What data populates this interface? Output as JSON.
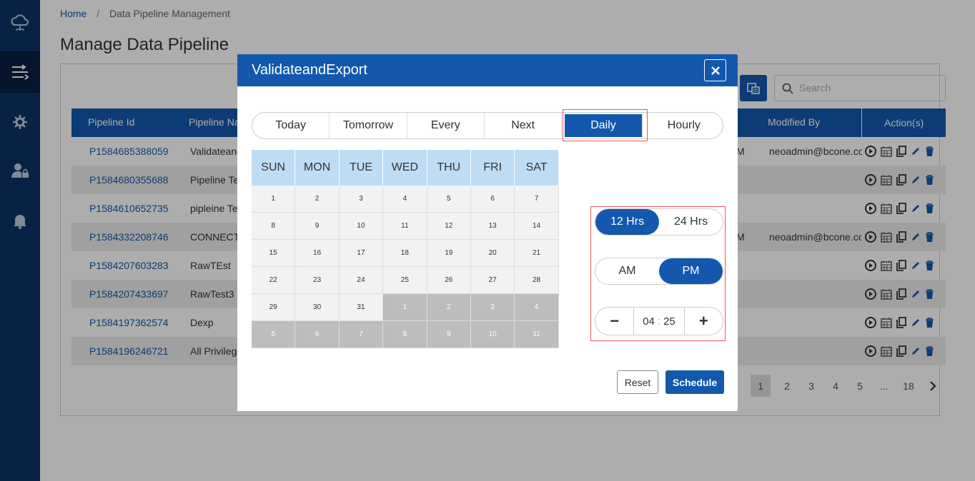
{
  "breadcrumb": {
    "home": "Home",
    "separator": "/",
    "current": "Data Pipeline Management"
  },
  "page": {
    "title": "Manage Data Pipeline"
  },
  "search": {
    "placeholder": "Search"
  },
  "table": {
    "headers": {
      "pipeline_id": "Pipeline Id",
      "pipeline_name": "Pipeline Na",
      "modified_by": "Modified By",
      "actions": "Action(s)"
    },
    "rows": [
      {
        "id": "P1584685388059",
        "name": "Validateand",
        "frag": "M",
        "modified": "neoadmin@bcone.co"
      },
      {
        "id": "P1584680355688",
        "name": "Pipeline Te",
        "frag": "",
        "modified": ""
      },
      {
        "id": "P1584610652735",
        "name": "pipleine Te",
        "frag": "",
        "modified": ""
      },
      {
        "id": "P1584332208746",
        "name": "CONNECTI",
        "frag": "M",
        "modified": "neoadmin@bcone.co"
      },
      {
        "id": "P1584207603283",
        "name": "RawTEst",
        "frag": "",
        "modified": ""
      },
      {
        "id": "P1584207433697",
        "name": "RawTest3",
        "frag": "",
        "modified": ""
      },
      {
        "id": "P1584197362574",
        "name": "Dexp",
        "frag": "",
        "modified": ""
      },
      {
        "id": "P1584196246721",
        "name": "All Privilege",
        "frag": "",
        "modified": ""
      }
    ]
  },
  "pagination": {
    "pages": [
      "1",
      "2",
      "3",
      "4",
      "5",
      "...",
      "18"
    ],
    "current": "1"
  },
  "modal": {
    "title": "ValidateandExport",
    "tabs": [
      "Today",
      "Tomorrow",
      "Every",
      "Next",
      "Daily",
      "Hourly"
    ],
    "active_tab": "Daily",
    "calendar": {
      "days": [
        "SUN",
        "MON",
        "TUE",
        "WED",
        "THU",
        "FRI",
        "SAT"
      ],
      "weeks": [
        [
          "1",
          "2",
          "3",
          "4",
          "5",
          "6",
          "7"
        ],
        [
          "8",
          "9",
          "10",
          "11",
          "12",
          "13",
          "14"
        ],
        [
          "15",
          "16",
          "17",
          "18",
          "19",
          "20",
          "21"
        ],
        [
          "22",
          "23",
          "24",
          "25",
          "26",
          "27",
          "28"
        ],
        [
          "29",
          "30",
          "31",
          "1",
          "2",
          "3",
          "4"
        ],
        [
          "5",
          "6",
          "7",
          "8",
          "9",
          "10",
          "11"
        ]
      ],
      "current_month_days_in_week5": 3
    },
    "format": {
      "options": [
        "12 Hrs",
        "24 Hrs"
      ],
      "selected": "12 Hrs"
    },
    "meridiem": {
      "options": [
        "AM",
        "PM"
      ],
      "selected": "PM"
    },
    "time": {
      "hour": "04",
      "separator": ":",
      "minute": "25",
      "minus": "−",
      "plus": "+"
    },
    "reset_label": "Reset",
    "schedule_label": "Schedule"
  },
  "colors": {
    "primary": "#1358ad",
    "sidebar": "#0c3366",
    "calendar_header": "#bfdcf5",
    "highlight": "#e55555"
  }
}
